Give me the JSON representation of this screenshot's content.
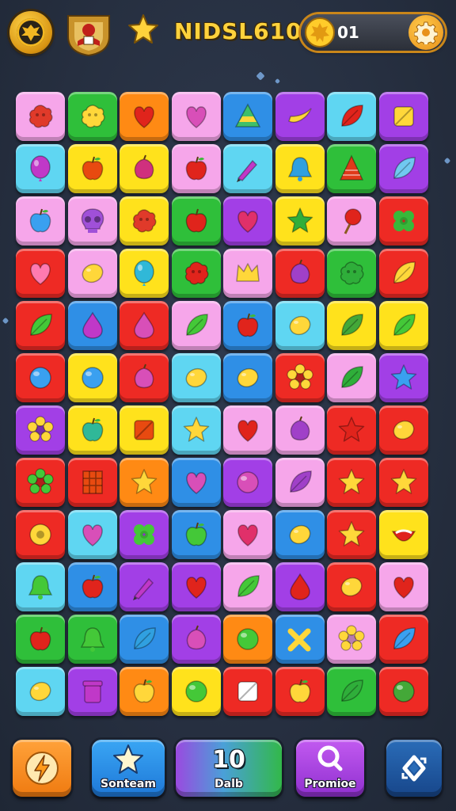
{
  "header": {
    "title": "NIDSL610",
    "coins": "01",
    "emblem_icon": "emblem-icon",
    "crest_icon": "crest-icon",
    "star_icon": "star-icon",
    "coin_icon": "coin-icon",
    "settings_icon": "gear-icon"
  },
  "board": {
    "rows": 12,
    "cols": 8,
    "tiles": [
      [
        [
          "pink",
          "blob",
          "#e03a2a"
        ],
        [
          "green",
          "blob",
          "#ffd73a"
        ],
        [
          "orange",
          "heart",
          "#e0241c"
        ],
        [
          "pink",
          "heart",
          "#d84fb8"
        ],
        [
          "blue",
          "triangle",
          "#ffd73a"
        ],
        [
          "purple",
          "banana",
          "#ffd73a"
        ],
        [
          "cyan",
          "leaf",
          "#e0241c"
        ],
        [
          "purple",
          "square",
          "#ffd73a"
        ]
      ],
      [
        [
          "cyan",
          "balloon",
          "#c038c8"
        ],
        [
          "yellow",
          "apple",
          "#e84a10"
        ],
        [
          "yellow",
          "plum",
          "#d0307e"
        ],
        [
          "pink",
          "apple",
          "#e0241c"
        ],
        [
          "cyan",
          "pen",
          "#c038c8"
        ],
        [
          "yellow",
          "bell",
          "#30a0e0"
        ],
        [
          "green",
          "tree",
          "#e03a1a"
        ],
        [
          "purple",
          "leaf",
          "#70c8f0"
        ]
      ],
      [
        [
          "pink",
          "apple",
          "#3aa0f0"
        ],
        [
          "pink",
          "skull",
          "#a050d8"
        ],
        [
          "yellow",
          "blob",
          "#e03a2a"
        ],
        [
          "green",
          "apple",
          "#e0241c"
        ],
        [
          "purple",
          "heart",
          "#e0306a"
        ],
        [
          "yellow",
          "star",
          "#2fae3a"
        ],
        [
          "pink",
          "lolly",
          "#e0241c"
        ],
        [
          "red",
          "clover",
          "#38b83a"
        ]
      ],
      [
        [
          "red",
          "heart",
          "#ff7ab0"
        ],
        [
          "pink",
          "lemon",
          "#ffd73a"
        ],
        [
          "yellow",
          "balloon",
          "#30b8d8"
        ],
        [
          "green",
          "blob",
          "#e0241c"
        ],
        [
          "pink",
          "crown",
          "#ffd73a"
        ],
        [
          "red",
          "plum",
          "#a040c8"
        ],
        [
          "green",
          "blob",
          "#2fae3a"
        ],
        [
          "red",
          "leaf",
          "#ffd73a"
        ]
      ],
      [
        [
          "red",
          "leaf",
          "#44c838"
        ],
        [
          "blue",
          "drop",
          "#c038c8"
        ],
        [
          "red",
          "drop",
          "#d84fb8"
        ],
        [
          "pink",
          "leaf",
          "#44c838"
        ],
        [
          "blue",
          "apple",
          "#e0241c"
        ],
        [
          "cyan",
          "lemon",
          "#ffd73a"
        ],
        [
          "yellow",
          "leaf",
          "#44a838"
        ],
        [
          "yellow",
          "leaf",
          "#44c838"
        ]
      ],
      [
        [
          "red",
          "circle",
          "#3aa0f0"
        ],
        [
          "yellow",
          "circle",
          "#3aa0f0"
        ],
        [
          "red",
          "plum",
          "#d84fb8"
        ],
        [
          "cyan",
          "lemon",
          "#ffd73a"
        ],
        [
          "blue",
          "lemon",
          "#ffd73a"
        ],
        [
          "red",
          "flower",
          "#ffd73a"
        ],
        [
          "pink",
          "leaf",
          "#2fae3a"
        ],
        [
          "purple",
          "star",
          "#3aa0f0"
        ]
      ],
      [
        [
          "purple",
          "flower",
          "#ffd73a"
        ],
        [
          "yellow",
          "apple",
          "#30b898"
        ],
        [
          "yellow",
          "square",
          "#e84a10"
        ],
        [
          "cyan",
          "star",
          "#ffd73a"
        ],
        [
          "pink",
          "heart",
          "#e0241c"
        ],
        [
          "pink",
          "plum",
          "#a040c8"
        ],
        [
          "red",
          "star",
          "#e0241c"
        ],
        [
          "red",
          "lemon",
          "#ffd73a"
        ]
      ],
      [
        [
          "red",
          "flower",
          "#44c838"
        ],
        [
          "red",
          "grid",
          "#e84a10"
        ],
        [
          "orange",
          "star",
          "#ffd73a"
        ],
        [
          "blue",
          "heart",
          "#d84fb8"
        ],
        [
          "purple",
          "circle",
          "#d84fb8"
        ],
        [
          "pink",
          "leaf",
          "#a040c8"
        ],
        [
          "red",
          "star",
          "#ffd73a"
        ],
        [
          "red",
          "star",
          "#ffd73a"
        ]
      ],
      [
        [
          "red",
          "donut",
          "#ffd73a"
        ],
        [
          "cyan",
          "heart",
          "#d84fb8"
        ],
        [
          "purple",
          "clover",
          "#44c838"
        ],
        [
          "blue",
          "apple",
          "#44c838"
        ],
        [
          "pink",
          "heart",
          "#e0306a"
        ],
        [
          "blue",
          "lemon",
          "#ffd73a"
        ],
        [
          "red",
          "star",
          "#ffd73a"
        ],
        [
          "yellow",
          "smile",
          "#e0241c"
        ]
      ],
      [
        [
          "cyan",
          "bell",
          "#44c838"
        ],
        [
          "blue",
          "apple",
          "#e0241c"
        ],
        [
          "purple",
          "pen",
          "#c038c8"
        ],
        [
          "purple",
          "heart",
          "#e0241c"
        ],
        [
          "pink",
          "leaf",
          "#44c838"
        ],
        [
          "purple",
          "drop",
          "#e0241c"
        ],
        [
          "red",
          "lemon",
          "#ffd73a"
        ],
        [
          "pink",
          "heart",
          "#e0241c"
        ]
      ],
      [
        [
          "green",
          "apple",
          "#e0241c"
        ],
        [
          "green",
          "bell",
          "#44c838"
        ],
        [
          "blue",
          "leaf",
          "#30a0e0"
        ],
        [
          "purple",
          "plum",
          "#d84fb8"
        ],
        [
          "orange",
          "circle",
          "#44c838"
        ],
        [
          "blue",
          "cross",
          "#ffd73a"
        ],
        [
          "pink",
          "flower",
          "#ffd73a"
        ],
        [
          "red",
          "leaf",
          "#3aa0f0"
        ]
      ],
      [
        [
          "cyan",
          "lemon",
          "#ffd73a"
        ],
        [
          "purple",
          "jar",
          "#c038c8"
        ],
        [
          "orange",
          "apple",
          "#ffd73a"
        ],
        [
          "yellow",
          "circle",
          "#44c838"
        ],
        [
          "red",
          "square",
          "#ffffff"
        ],
        [
          "red",
          "apple",
          "#ffd73a"
        ],
        [
          "green",
          "leaf",
          "#2fae3a"
        ],
        [
          "red",
          "circle",
          "#44a838"
        ]
      ]
    ]
  },
  "bottom": {
    "buttons": [
      {
        "name": "boost-button",
        "label": "",
        "big": "",
        "icon": "lightning-icon",
        "color": "orange"
      },
      {
        "name": "screen-button",
        "label": "Sonteam",
        "big": "",
        "icon": "star-icon",
        "color": "blue"
      },
      {
        "name": "moves-counter",
        "label": "Dalb",
        "big": "10",
        "icon": "",
        "color": "green"
      },
      {
        "name": "promote-button",
        "label": "Promioe",
        "big": "",
        "icon": "search-icon",
        "color": "purple"
      },
      {
        "name": "shuffle-button",
        "label": "",
        "big": "",
        "icon": "shuffle-icon",
        "color": "navy"
      }
    ]
  },
  "colors": {
    "pink": "#f6a6ea",
    "green": "#2fbf3a",
    "orange": "#ff8a14",
    "purple": "#a23fe6",
    "blue": "#2f8fe6",
    "cyan": "#5fd6f2",
    "yellow": "#ffe21c",
    "red": "#ee2a24",
    "navy": "#215ea8",
    "accent": "#ffd23c"
  }
}
